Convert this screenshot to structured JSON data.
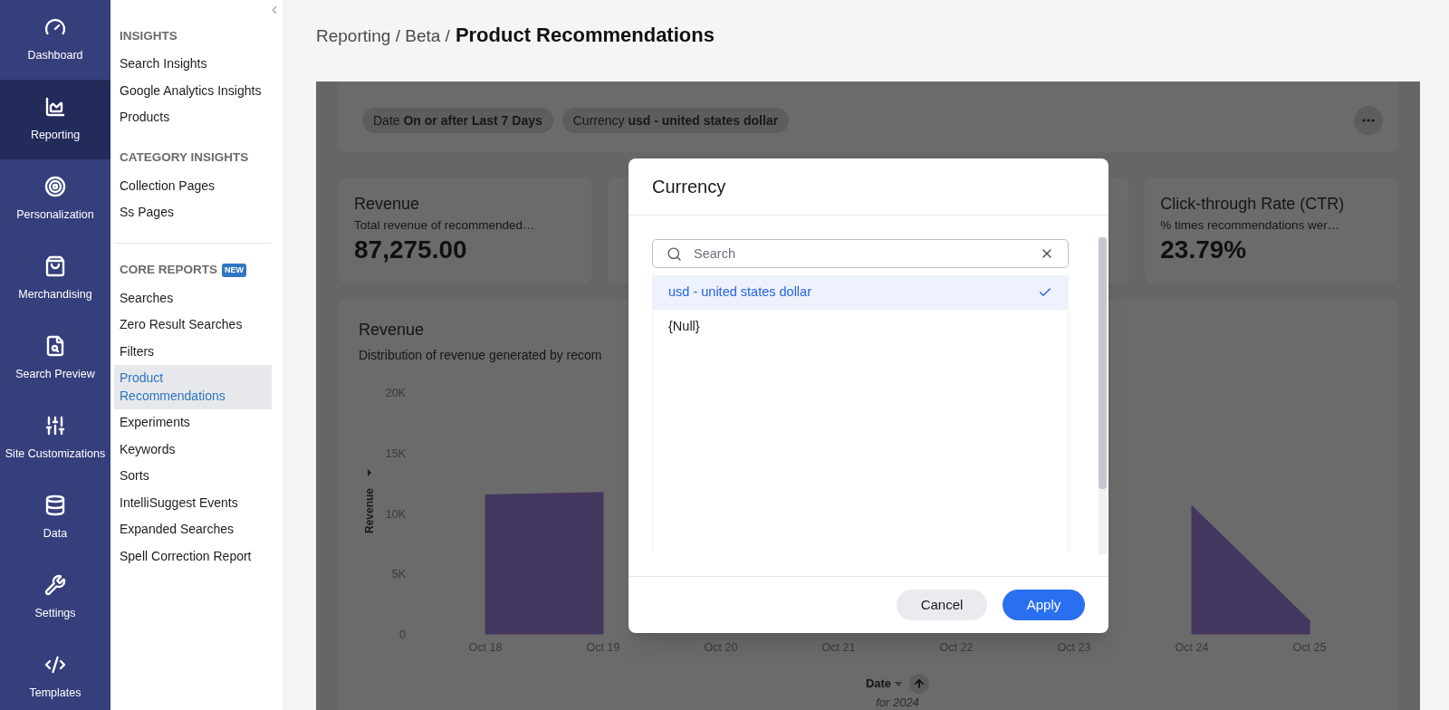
{
  "rail": [
    {
      "label": "Dashboard",
      "selected": false
    },
    {
      "label": "Reporting",
      "selected": true
    },
    {
      "label": "Personalization",
      "selected": false
    },
    {
      "label": "Merchandising",
      "selected": false
    },
    {
      "label": "Search Preview",
      "selected": false
    },
    {
      "label": "Site Customizations",
      "selected": false
    },
    {
      "label": "Data",
      "selected": false
    },
    {
      "label": "Settings",
      "selected": false
    },
    {
      "label": "Templates",
      "selected": false
    }
  ],
  "sidebar": {
    "sections": [
      {
        "heading": "INSIGHTS",
        "items": [
          {
            "label": "Search Insights",
            "selected": false
          },
          {
            "label": "Google Analytics Insights",
            "selected": false
          },
          {
            "label": "Products",
            "selected": false
          }
        ]
      },
      {
        "heading": "CATEGORY INSIGHTS",
        "items": [
          {
            "label": "Collection Pages",
            "selected": false
          },
          {
            "label": "Ss Pages",
            "selected": false
          }
        ]
      },
      {
        "heading": "CORE REPORTS",
        "badge": "NEW",
        "items": [
          {
            "label": "Searches",
            "selected": false
          },
          {
            "label": "Zero Result Searches",
            "selected": false
          },
          {
            "label": "Filters",
            "selected": false
          },
          {
            "label": "Product Recommendations",
            "selected": true
          },
          {
            "label": "Experiments",
            "selected": false
          },
          {
            "label": "Keywords",
            "selected": false
          },
          {
            "label": "Sorts",
            "selected": false
          },
          {
            "label": "IntelliSuggest Events",
            "selected": false
          },
          {
            "label": "Expanded Searches",
            "selected": false
          },
          {
            "label": "Spell Correction Report",
            "selected": false
          }
        ]
      }
    ]
  },
  "breadcrumb": {
    "path": "Reporting / Beta /",
    "current": "Product Recommendations"
  },
  "filters": [
    {
      "label": "Date",
      "value": "On or after Last 7 Days"
    },
    {
      "label": "Currency",
      "value": "usd - united states dollar"
    }
  ],
  "metrics": [
    {
      "title": "Revenue",
      "description": "Total revenue of recommended…",
      "value": "87,275.00"
    },
    {
      "title": "Click-through Rate (CTR)",
      "description": "% times recommendations wer…",
      "value": "23.79%"
    }
  ],
  "chart": {
    "title": "Revenue",
    "description": "Distribution of revenue generated by recom",
    "sort_note": "for 2024",
    "chart_data": {
      "type": "area",
      "xlabel": "Date",
      "ylabel": "Revenue",
      "categories": [
        "Oct 18",
        "Oct 19",
        "Oct 20",
        "Oct 21",
        "Oct 22",
        "Oct 23",
        "Oct 24",
        "Oct 25"
      ],
      "series": [
        {
          "color": "#44375f",
          "values": [
            11500,
            11700,
            null,
            null,
            null,
            null,
            10600,
            1100
          ]
        }
      ],
      "ylim": [
        0,
        20000
      ],
      "yticks": [
        {
          "value": 0,
          "label": "0"
        },
        {
          "value": 5000,
          "label": "5K"
        },
        {
          "value": 10000,
          "label": "10K"
        },
        {
          "value": 15000,
          "label": "15K"
        },
        {
          "value": 20000,
          "label": "20K"
        }
      ]
    }
  },
  "modal": {
    "title": "Currency",
    "search": {
      "placeholder": "Search"
    },
    "options": [
      {
        "label": "usd - united states dollar",
        "selected": true
      },
      {
        "label": "{Null}",
        "selected": false
      }
    ],
    "buttons": [
      {
        "label": "Cancel",
        "kind": "secondary"
      },
      {
        "label": "Apply",
        "kind": "primary"
      }
    ]
  }
}
